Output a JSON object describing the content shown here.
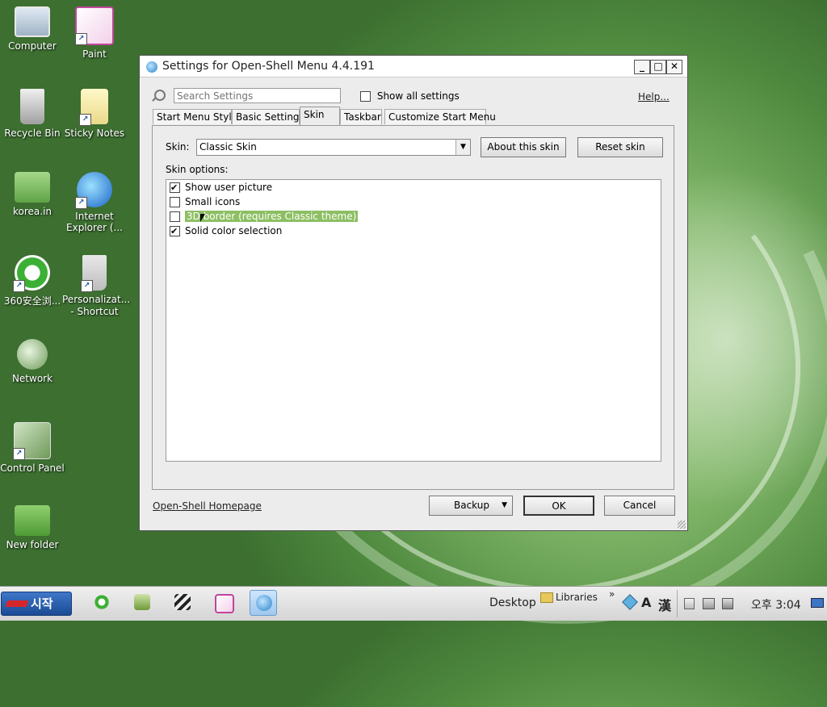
{
  "desktop": {
    "icons": [
      {
        "label": "Computer"
      },
      {
        "label": "Paint"
      },
      {
        "label": "Recycle Bin"
      },
      {
        "label": "Sticky Notes"
      },
      {
        "label": "korea.in"
      },
      {
        "label": "Internet Explorer (..."
      },
      {
        "label": "360安全浏..."
      },
      {
        "label": "Personalizat... - Shortcut"
      },
      {
        "label": "Network"
      },
      {
        "label": "Control Panel"
      },
      {
        "label": "New folder"
      }
    ]
  },
  "dialog": {
    "title": "Settings for Open-Shell Menu 4.4.191",
    "search_placeholder": "Search Settings",
    "show_all_label": "Show all settings",
    "show_all_checked": false,
    "help_label": "Help...",
    "tabs": [
      {
        "label": "Start Menu Style"
      },
      {
        "label": "Basic Settings"
      },
      {
        "label": "Skin",
        "active": true
      },
      {
        "label": "Taskbar"
      },
      {
        "label": "Customize Start Menu"
      }
    ],
    "skin_label": "Skin:",
    "skin_value": "Classic Skin",
    "about_button": "About this skin",
    "reset_button": "Reset skin",
    "options_label": "Skin options:",
    "options": [
      {
        "label": "Show user picture",
        "checked": true
      },
      {
        "label": "Small icons",
        "checked": false
      },
      {
        "label": "3D border (requires Classic theme)",
        "checked": false,
        "selected": true
      },
      {
        "label": "Solid color selection",
        "checked": true
      }
    ],
    "homepage_link": "Open-Shell Homepage",
    "backup_button": "Backup",
    "ok_button": "OK",
    "cancel_button": "Cancel"
  },
  "taskbar": {
    "start_label": "시작",
    "desktop_label": "Desktop",
    "libraries_label": "Libraries",
    "overflow": "»",
    "ime_a": "A",
    "ime_han": "漢",
    "clock": "오후 3:04"
  },
  "colors": {
    "selection": "#8dbf63",
    "start_button": "#1b4a94"
  }
}
